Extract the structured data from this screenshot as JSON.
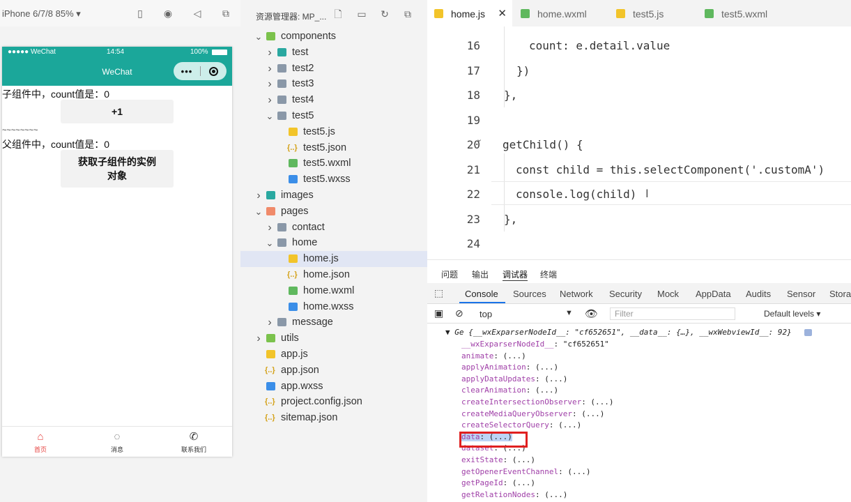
{
  "simulator": {
    "device": "iPhone 6/7/8 85% ▾",
    "carrier": "●●●●● WeChat",
    "time": "14:54",
    "battery": "100%",
    "nav_title": "WeChat",
    "capsule_dots": "•••",
    "child_count_text": "子组件中，count值是：0",
    "plus_button": "+1",
    "divider": "~~~~~~~~",
    "parent_count_text": "父组件中，count值是：0",
    "get_child_button_line1": "获取子组件的实例",
    "get_child_button_line2": "对象",
    "tabbar": [
      {
        "label": "首页",
        "icon": "home-icon",
        "color": "#e64340"
      },
      {
        "label": "消息",
        "icon": "message-icon",
        "color": "#333"
      },
      {
        "label": "联系我们",
        "icon": "phone-icon",
        "color": "#333"
      }
    ]
  },
  "explorer": {
    "title": "资源管理器: MP_...",
    "tree": [
      {
        "label": "components",
        "type": "folder-green",
        "chev": "v",
        "indent": 0
      },
      {
        "label": "test",
        "type": "folder-teal",
        "chev": ">",
        "indent": 1
      },
      {
        "label": "test2",
        "type": "folder",
        "chev": ">",
        "indent": 1
      },
      {
        "label": "test3",
        "type": "folder",
        "chev": ">",
        "indent": 1
      },
      {
        "label": "test4",
        "type": "folder",
        "chev": ">",
        "indent": 1
      },
      {
        "label": "test5",
        "type": "folder",
        "chev": "v",
        "indent": 1
      },
      {
        "label": "test5.js",
        "type": "js",
        "chev": "",
        "indent": 2
      },
      {
        "label": "test5.json",
        "type": "json",
        "chev": "",
        "indent": 2
      },
      {
        "label": "test5.wxml",
        "type": "wxml",
        "chev": "",
        "indent": 2
      },
      {
        "label": "test5.wxss",
        "type": "wxss",
        "chev": "",
        "indent": 2
      },
      {
        "label": "images",
        "type": "img",
        "chev": ">",
        "indent": 0
      },
      {
        "label": "pages",
        "type": "pages",
        "chev": "v",
        "indent": 0
      },
      {
        "label": "contact",
        "type": "folder",
        "chev": ">",
        "indent": 1
      },
      {
        "label": "home",
        "type": "folder",
        "chev": "v",
        "indent": 1
      },
      {
        "label": "home.js",
        "type": "js",
        "chev": "",
        "indent": 2,
        "selected": true
      },
      {
        "label": "home.json",
        "type": "json",
        "chev": "",
        "indent": 2
      },
      {
        "label": "home.wxml",
        "type": "wxml",
        "chev": "",
        "indent": 2
      },
      {
        "label": "home.wxss",
        "type": "wxss",
        "chev": "",
        "indent": 2
      },
      {
        "label": "message",
        "type": "folder",
        "chev": ">",
        "indent": 1
      },
      {
        "label": "utils",
        "type": "folder-green",
        "chev": ">",
        "indent": 0
      },
      {
        "label": "app.js",
        "type": "js",
        "chev": "",
        "indent": 0
      },
      {
        "label": "app.json",
        "type": "json",
        "chev": "",
        "indent": 0
      },
      {
        "label": "app.wxss",
        "type": "wxss",
        "chev": "",
        "indent": 0
      },
      {
        "label": "project.config.json",
        "type": "json",
        "chev": "",
        "indent": 0
      },
      {
        "label": "sitemap.json",
        "type": "json",
        "chev": "",
        "indent": 0
      }
    ]
  },
  "editor": {
    "tabs": [
      {
        "label": "home.js",
        "type": "js",
        "active": true,
        "close": "✕"
      },
      {
        "label": "home.wxml",
        "type": "wxml"
      },
      {
        "label": "test5.js",
        "type": "js"
      },
      {
        "label": "test5.wxml",
        "type": "wxml"
      }
    ],
    "lines": [
      {
        "num": "16",
        "code": "count: e.detail.value"
      },
      {
        "num": "17",
        "code": "})"
      },
      {
        "num": "18",
        "code": "},"
      },
      {
        "num": "19",
        "code": ""
      },
      {
        "num": "20",
        "code": "getChild() {"
      },
      {
        "num": "21",
        "code": "const child = this.selectComponent('.customA')"
      },
      {
        "num": "22",
        "code": "console.log(child)"
      },
      {
        "num": "23",
        "code": "},"
      },
      {
        "num": "24",
        "code": ""
      }
    ]
  },
  "devtools": {
    "top_tabs": [
      "问题",
      "输出",
      "调试器",
      "终端"
    ],
    "tabs": [
      "Console",
      "Sources",
      "Network",
      "Security",
      "Mock",
      "AppData",
      "Audits",
      "Sensor",
      "Storag"
    ],
    "context": "top",
    "filter_placeholder": "Filter",
    "levels": "Default levels ▾",
    "summary": "▼ Ge {__wxExparserNodeId__: \"cf652651\", __data__: {…}, __wxWebviewId__: 92}",
    "entries": [
      {
        "key": "__wxExparserNodeId__",
        "val": ": \"cf652651\""
      },
      {
        "key": "animate",
        "val": ": (...)"
      },
      {
        "key": "applyAnimation",
        "val": ": (...)"
      },
      {
        "key": "applyDataUpdates",
        "val": ": (...)"
      },
      {
        "key": "clearAnimation",
        "val": ": (...)"
      },
      {
        "key": "createIntersectionObserver",
        "val": ": (...)"
      },
      {
        "key": "createMediaQueryObserver",
        "val": ": (...)"
      },
      {
        "key": "createSelectorQuery",
        "val": ": (...)"
      },
      {
        "key": "data",
        "val": ": (...)"
      },
      {
        "key": "dataset",
        "val": ": (...)"
      },
      {
        "key": "exitState",
        "val": ": (...)"
      },
      {
        "key": "getOpenerEventChannel",
        "val": ": (...)"
      },
      {
        "key": "getPageId",
        "val": ": (...)"
      },
      {
        "key": "getRelationNodes",
        "val": ": (...)"
      }
    ]
  }
}
